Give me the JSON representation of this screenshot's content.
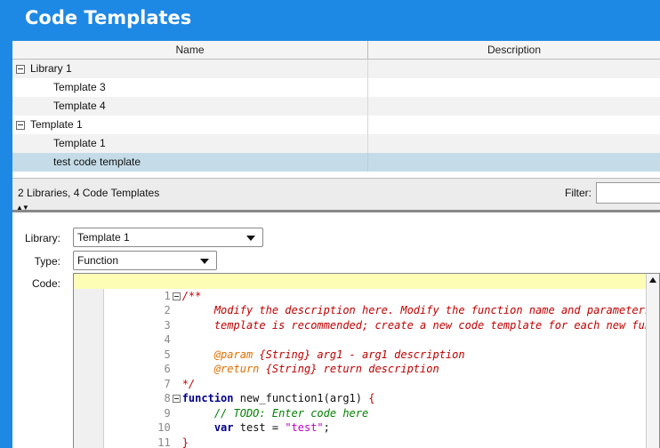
{
  "window": {
    "title": "Code Templates"
  },
  "table": {
    "columns": {
      "name": "Name",
      "description": "Description"
    },
    "rows": [
      {
        "name": "Library 1",
        "type": "library"
      },
      {
        "name": "Template 3",
        "type": "template"
      },
      {
        "name": "Template 4",
        "type": "template"
      },
      {
        "name": "Template 1",
        "type": "library"
      },
      {
        "name": "Template 1",
        "type": "template"
      },
      {
        "name": "test code template",
        "type": "template",
        "selected": true
      }
    ]
  },
  "status": {
    "summary": "2 Libraries, 4 Code Templates",
    "filter_label": "Filter:",
    "filter_value": ""
  },
  "form": {
    "library_label": "Library:",
    "library_value": "Template 1",
    "type_label": "Type:",
    "type_value": "Function",
    "code_label": "Code:"
  },
  "code": {
    "line_numbers": [
      "1",
      "2",
      "3",
      "4",
      "5",
      "6",
      "7",
      "8",
      "9",
      "10",
      "11"
    ],
    "l1": "/**",
    "l2": "     Modify the description here. Modify the function name and parameters as needed",
    "l3": "     template is recommended; create a new code template for each new function.",
    "l5_tag": "@param",
    "l5_rest": " {String} arg1 - arg1 description",
    "l6_tag": "@return",
    "l6_rest": " {String} return description",
    "l7": "*/",
    "l8_kw": "function",
    "l8_rest": " new_function1(arg1) ",
    "l8_brace": "{",
    "l9": "     // TODO: Enter code here",
    "l10_kw": "var",
    "l10_mid": " test = ",
    "l10_str": "\"test\"",
    "l10_end": ";",
    "l11": "}"
  },
  "colors": {
    "accent": "#1e88e5",
    "selected_row": "#c5dce8",
    "highlight_line": "#fdfdb5"
  }
}
